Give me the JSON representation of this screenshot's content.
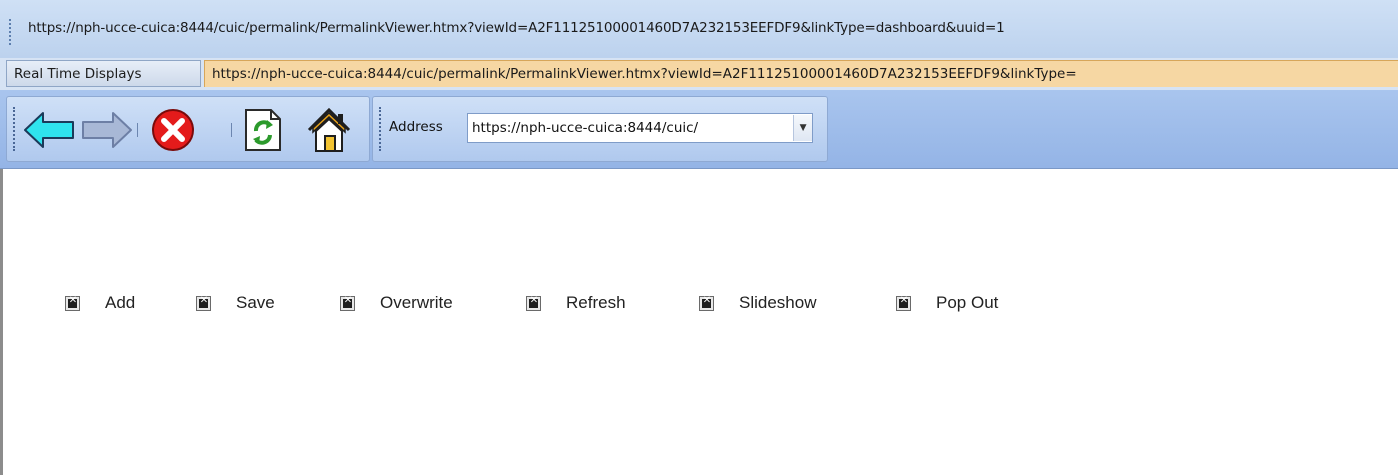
{
  "window": {
    "url": "https://nph-ucce-cuica:8444/cuic/permalink/PermalinkViewer.htmx?viewId=A2F11125100001460D7A232153EEFDF9&linkType=dashboard&uuid=1"
  },
  "tabs": [
    {
      "label": "Real Time Displays",
      "active": false
    },
    {
      "label": "https://nph-ucce-cuica:8444/cuic/permalink/PermalinkViewer.htmx?viewId=A2F11125100001460D7A232153EEFDF9&linkType=",
      "active": true
    }
  ],
  "toolbar": {
    "buttons": [
      {
        "icon": "back-arrow-icon"
      },
      {
        "icon": "forward-arrow-icon"
      },
      {
        "icon": "stop-icon"
      },
      {
        "icon": "refresh-icon"
      },
      {
        "icon": "home-icon"
      }
    ],
    "address_label": "Address",
    "address_value": "https://nph-ucce-cuica:8444/cuic/"
  },
  "actions": [
    {
      "label": "Add",
      "icon": "broken-image-icon"
    },
    {
      "label": "Save",
      "icon": "broken-image-icon"
    },
    {
      "label": "Overwrite",
      "icon": "broken-image-icon"
    },
    {
      "label": "Refresh",
      "icon": "broken-image-icon"
    },
    {
      "label": "Slideshow",
      "icon": "broken-image-icon"
    },
    {
      "label": "Pop Out",
      "icon": "broken-image-icon"
    }
  ],
  "colors": {
    "active_tab": "#f6d7a3",
    "toolbar": "#a9c5ee",
    "back_arrow": "#2fe3ee",
    "forward_arrow": "#a8b8d6",
    "stop": "#e41b1b",
    "refresh": "#2c9a2c",
    "home_roof": "#e8a21a"
  }
}
